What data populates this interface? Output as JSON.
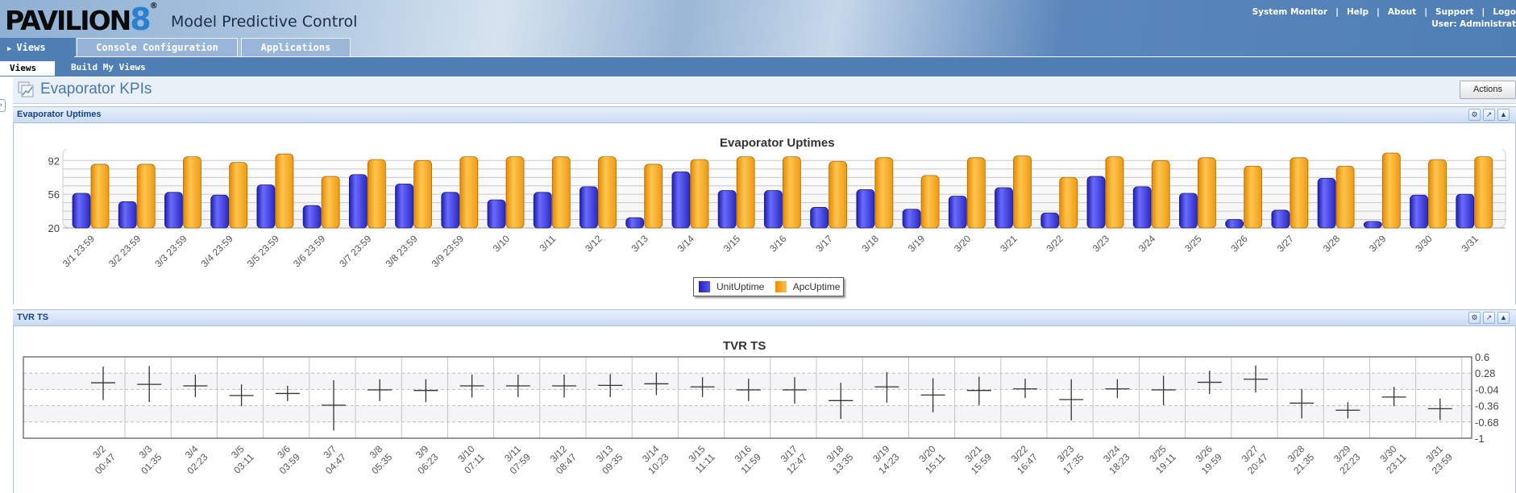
{
  "brand": {
    "logo_text": "PAVILION",
    "logo_number": "8",
    "logo_reg": "®",
    "app_title": "Model Predictive Control"
  },
  "top_links": [
    "System Monitor",
    "Help",
    "About",
    "Support",
    "Logo"
  ],
  "user_line": "User: Administrat",
  "main_tabs": [
    {
      "label": "Views",
      "active": true,
      "icon": "triangle-right-icon"
    },
    {
      "label": "Console Configuration",
      "active": false
    },
    {
      "label": "Applications",
      "active": false
    }
  ],
  "sub_nav": [
    {
      "label": "Views",
      "active": true
    },
    {
      "label": "Build My Views",
      "active": false
    }
  ],
  "page": {
    "title": "Evaporator KPIs",
    "icon": "chart-icon",
    "actions_label": "Actions"
  },
  "panels": [
    {
      "title": "Evaporator Uptimes",
      "icons": [
        "gear-icon",
        "popout-icon",
        "collapse-icon"
      ]
    },
    {
      "title": "TVR TS",
      "icons": [
        "gear-icon",
        "popout-icon",
        "collapse-icon"
      ]
    }
  ],
  "colors": {
    "unit": "#3535d8",
    "apc": "#f5a20f",
    "header_blue": "#4f7fb5",
    "title_blue": "#4a78a8"
  },
  "chart_data": [
    {
      "type": "bar",
      "title": "Evaporator Uptimes",
      "xlabel": "",
      "ylabel": "",
      "ylim": [
        20,
        100
      ],
      "yticks": [
        20,
        56,
        92
      ],
      "grid": true,
      "legend": "bottom-center",
      "categories": [
        "3/1 23:59",
        "3/2 23:59",
        "3/3 23:59",
        "3/4 23:59",
        "3/5 23:59",
        "3/6 23:59",
        "3/7 23:59",
        "3/8 23:59",
        "3/9 23:59",
        "3/10",
        "3/11",
        "3/12",
        "3/13",
        "3/14",
        "3/15",
        "3/16",
        "3/17",
        "3/18",
        "3/19",
        "3/20",
        "3/21",
        "3/22",
        "3/23",
        "3/24",
        "3/25",
        "3/26",
        "3/27",
        "3/28",
        "3/29",
        "3/30",
        "3/31"
      ],
      "series": [
        {
          "name": "UnitUptime",
          "values": [
            57,
            48,
            58,
            55,
            66,
            44,
            77,
            67,
            58,
            50,
            58,
            64,
            31,
            80,
            60,
            60,
            42,
            61,
            40,
            54,
            63,
            36,
            75,
            64,
            57,
            29,
            39,
            73,
            27,
            55,
            56
          ]
        },
        {
          "name": "ApcUptime",
          "values": [
            88,
            88,
            96,
            90,
            99,
            75,
            93,
            92,
            96,
            96,
            96,
            96,
            88,
            93,
            96,
            96,
            91,
            95,
            76,
            95,
            97,
            74,
            96,
            92,
            95,
            86,
            95,
            86,
            100,
            93,
            96
          ]
        }
      ]
    },
    {
      "type": "scatter",
      "title": "TVR TS",
      "xlabel": "",
      "ylabel": "",
      "ylim": [
        -1,
        0.6
      ],
      "yticks": [
        0.6,
        0.28,
        -0.04,
        -0.36,
        -0.68,
        -1
      ],
      "y_axis_side": "right",
      "grid": true,
      "marker": "cross with error range",
      "categories": [
        "3/2|00:47",
        "3/3|01:35",
        "3/4|02:23",
        "3/5|03:11",
        "3/6|03:59",
        "3/7|04:47",
        "3/8|05:35",
        "3/9|06:23",
        "3/10|07:11",
        "3/11|07:59",
        "3/12|08:47",
        "3/13|09:35",
        "3/14|10:23",
        "3/15|11:11",
        "3/16|11:59",
        "3/17|12:47",
        "3/18|13:35",
        "3/19|14:23",
        "3/20|15:11",
        "3/21|15:59",
        "3/22|16:47",
        "3/23|17:35",
        "3/24|18:23",
        "3/25|19:11",
        "3/26|19:59",
        "3/27|20:47",
        "3/28|21:35",
        "3/29|22:23",
        "3/30|23:11",
        "3/31|23:59"
      ],
      "values": [
        0.09,
        0.06,
        0.03,
        -0.16,
        -0.12,
        -0.35,
        -0.05,
        -0.06,
        0.03,
        0.03,
        0.03,
        0.04,
        0.07,
        0.01,
        -0.05,
        -0.05,
        -0.26,
        0.01,
        -0.15,
        -0.06,
        -0.03,
        -0.24,
        -0.03,
        -0.05,
        0.1,
        0.16,
        -0.31,
        -0.45,
        -0.19,
        -0.42
      ],
      "high": [
        0.41,
        0.42,
        0.25,
        0.06,
        0.03,
        0.14,
        0.16,
        0.16,
        0.25,
        0.25,
        0.25,
        0.26,
        0.29,
        0.2,
        0.17,
        0.2,
        0.09,
        0.3,
        0.18,
        0.21,
        0.17,
        0.16,
        0.16,
        0.23,
        0.33,
        0.43,
        -0.03,
        -0.29,
        0.01,
        -0.22
      ],
      "low": [
        -0.25,
        -0.29,
        -0.19,
        -0.37,
        -0.27,
        -0.85,
        -0.27,
        -0.29,
        -0.2,
        -0.19,
        -0.2,
        -0.19,
        -0.15,
        -0.19,
        -0.27,
        -0.32,
        -0.62,
        -0.3,
        -0.49,
        -0.35,
        -0.21,
        -0.65,
        -0.21,
        -0.35,
        -0.13,
        -0.1,
        -0.61,
        -0.61,
        -0.37,
        -0.64
      ]
    }
  ]
}
